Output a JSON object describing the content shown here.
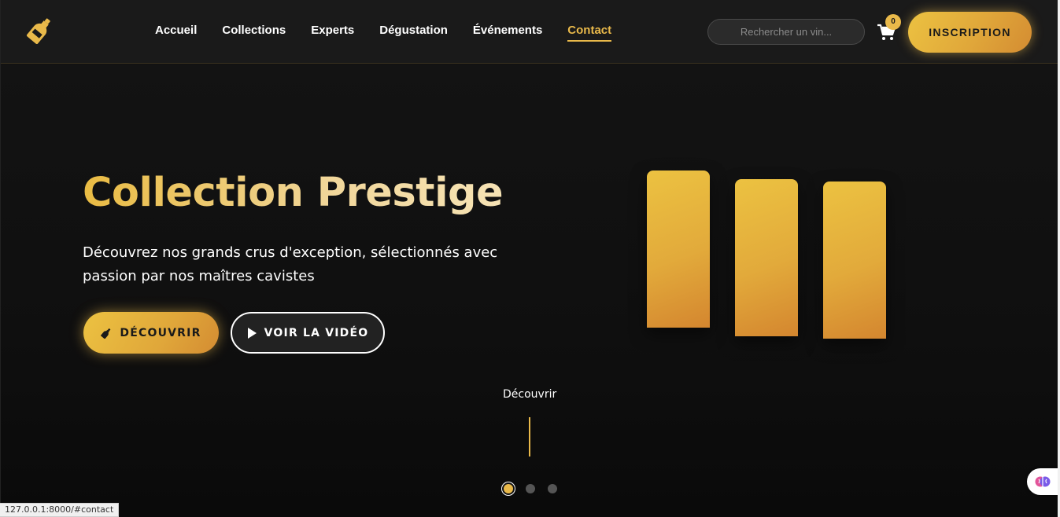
{
  "header": {
    "nav": [
      {
        "label": "Accueil",
        "active": false
      },
      {
        "label": "Collections",
        "active": false
      },
      {
        "label": "Experts",
        "active": false
      },
      {
        "label": "Dégustation",
        "active": false
      },
      {
        "label": "Événements",
        "active": false
      },
      {
        "label": "Contact",
        "active": true
      }
    ],
    "search_placeholder": "Rechercher un vin...",
    "cart_count": "0",
    "signup_label": "INSCRIPTION"
  },
  "hero": {
    "title": "Collection Prestige",
    "subtitle": "Découvrez nos grands crus d'exception, sélectionnés avec passion par nos maîtres cavistes",
    "primary_button": "DÉCOUVRIR",
    "secondary_button": "VOIR LA VIDÉO",
    "scroll_label": "Découvrir"
  },
  "carousel": {
    "slides": 3,
    "active_index": 0
  },
  "status_bar": {
    "url": "127.0.0.1:8000/#contact"
  },
  "colors": {
    "accent": "#e9b94a",
    "background": "#111111"
  },
  "icons": [
    "wine-bottle-logo-icon",
    "cart-icon",
    "wine-bottle-icon",
    "play-icon",
    "brain-extension-icon"
  ]
}
